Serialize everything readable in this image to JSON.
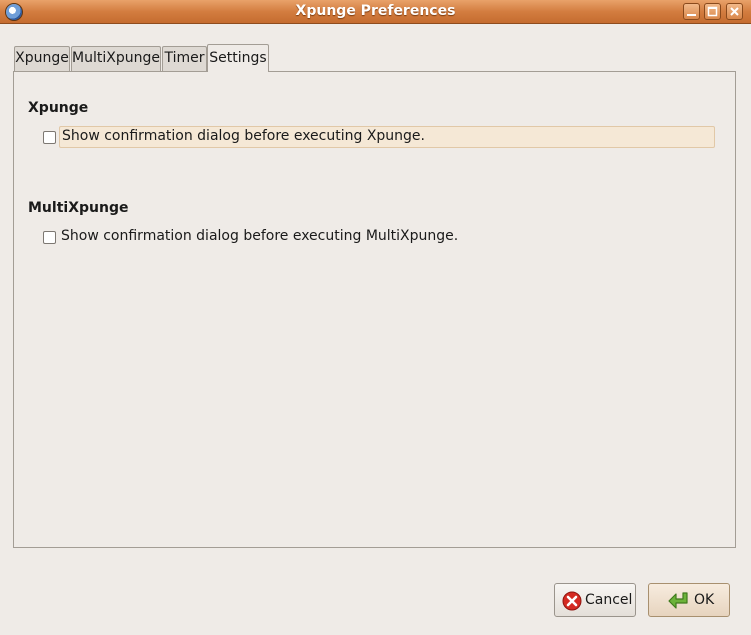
{
  "window": {
    "title": "Xpunge Preferences",
    "icon": "thunderbird-app-icon"
  },
  "tabs": [
    {
      "label": "Xpunge",
      "active": false
    },
    {
      "label": "MultiXpunge",
      "active": false
    },
    {
      "label": "Timer",
      "active": false
    },
    {
      "label": "Settings",
      "active": true
    }
  ],
  "settings": {
    "xpunge": {
      "title": "Xpunge",
      "checkbox_label": "Show confirmation dialog before executing Xpunge.",
      "checked": false
    },
    "multixpunge": {
      "title": "MultiXpunge",
      "checkbox_label": "Show confirmation dialog before executing MultiXpunge.",
      "checked": false
    }
  },
  "buttons": {
    "cancel_label": "Cancel",
    "ok_label": "OK"
  }
}
